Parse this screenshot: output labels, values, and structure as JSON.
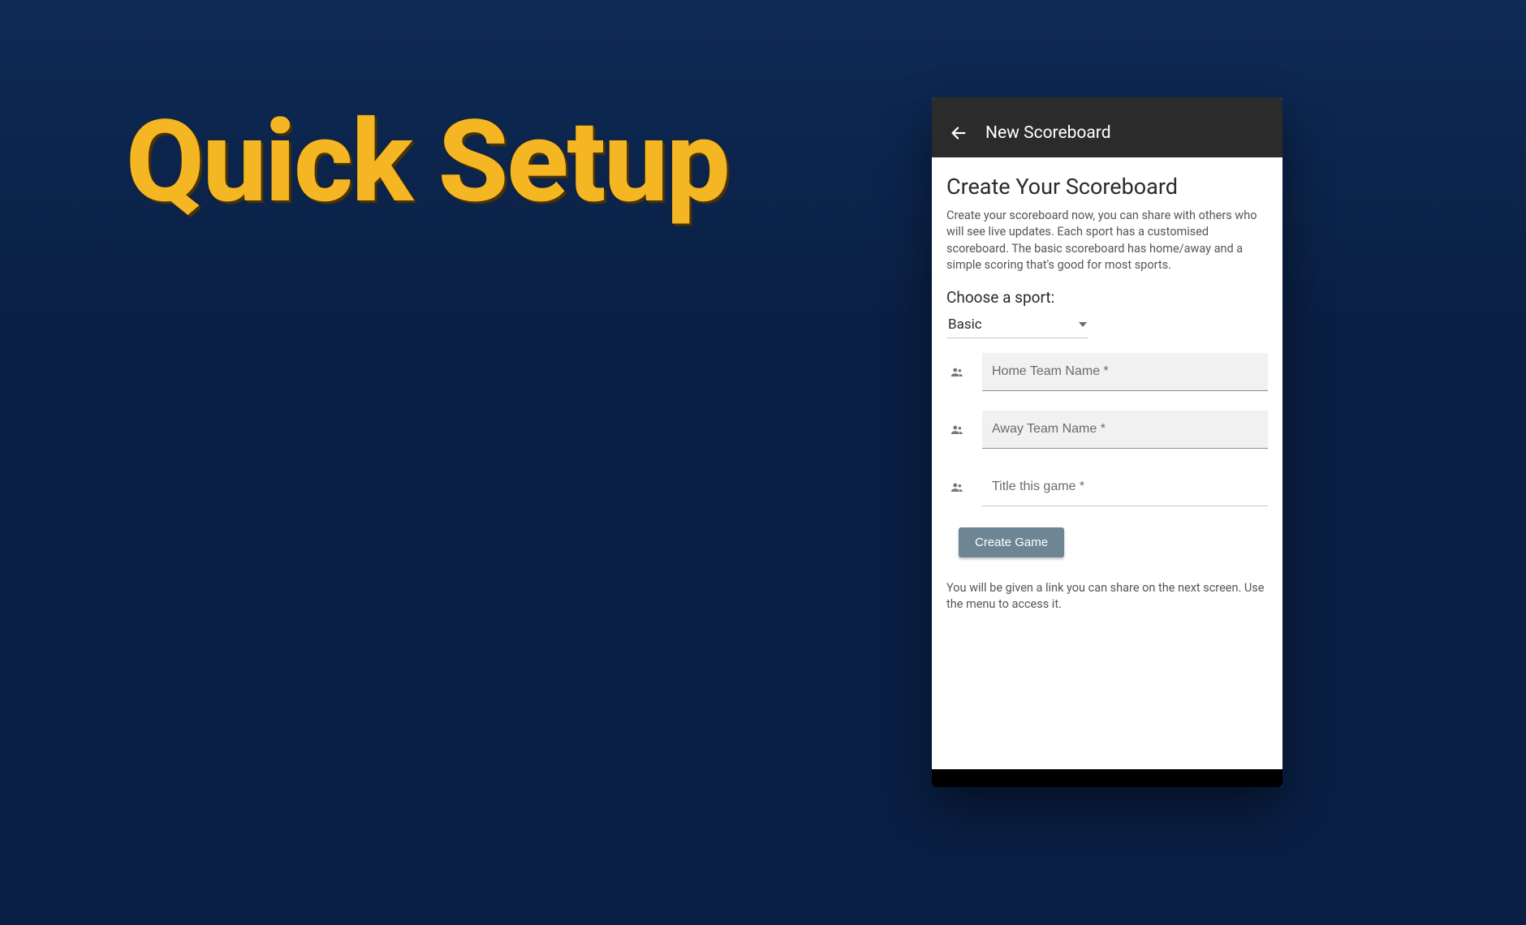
{
  "hero_title": "Quick Setup",
  "app_bar": {
    "title": "New Scoreboard"
  },
  "page": {
    "heading": "Create Your Scoreboard",
    "description": "Create your scoreboard now, you can share with others who will see live updates. Each sport has a customised scoreboard. The basic scoreboard has home/away and a simple scoring that's good for most sports.",
    "choose_label": "Choose a sport:"
  },
  "sport_select": {
    "value": "Basic"
  },
  "fields": {
    "home_placeholder": "Home Team Name *",
    "away_placeholder": "Away Team Name *",
    "title_placeholder": "Title this game *"
  },
  "button": {
    "create_label": "Create Game"
  },
  "footer_note": "You will be given a link you can share on the next screen. Use the menu to access it."
}
